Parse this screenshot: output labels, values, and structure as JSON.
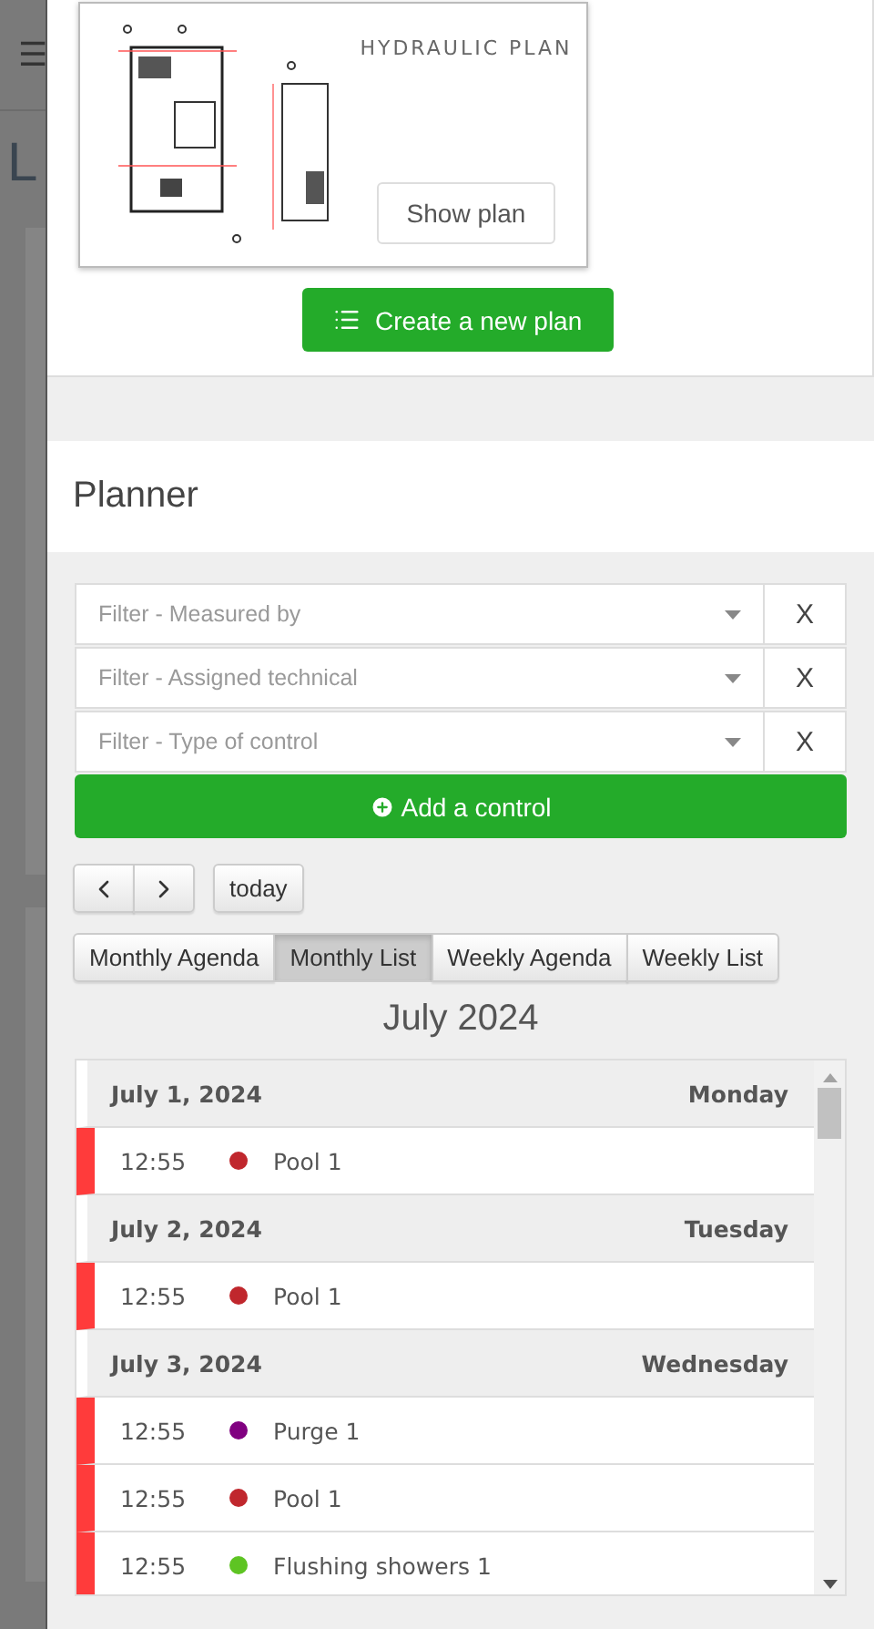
{
  "background": {
    "menu_glyph": "☰",
    "heading": "L"
  },
  "plan_card": {
    "title": "HYDRAULIC PLAN",
    "button": "Show plan"
  },
  "create_button": "Create a new plan",
  "planner": {
    "title": "Planner",
    "filters": [
      {
        "placeholder": "Filter - Measured by",
        "clear": "X"
      },
      {
        "placeholder": "Filter - Assigned technical",
        "clear": "X"
      },
      {
        "placeholder": "Filter - Type of control",
        "clear": "X"
      }
    ],
    "add_button": "Add a control",
    "today_button": "today",
    "views": [
      {
        "label": "Monthly Agenda",
        "selected": false
      },
      {
        "label": "Monthly List",
        "selected": true
      },
      {
        "label": "Weekly Agenda",
        "selected": false
      },
      {
        "label": "Weekly List",
        "selected": false
      }
    ],
    "calendar_title": "July 2024",
    "days": [
      {
        "date": "July 1, 2024",
        "weekday": "Monday",
        "events": [
          {
            "time": "12:55",
            "title": "Pool 1",
            "color": "#c0272d"
          }
        ]
      },
      {
        "date": "July 2, 2024",
        "weekday": "Tuesday",
        "events": [
          {
            "time": "12:55",
            "title": "Pool 1",
            "color": "#c0272d"
          }
        ]
      },
      {
        "date": "July 3, 2024",
        "weekday": "Wednesday",
        "events": [
          {
            "time": "12:55",
            "title": "Purge 1",
            "color": "#800080"
          },
          {
            "time": "12:55",
            "title": "Pool 1",
            "color": "#c0272d"
          },
          {
            "time": "12:55",
            "title": "Flushing showers 1",
            "color": "#5ec423"
          }
        ]
      }
    ]
  }
}
